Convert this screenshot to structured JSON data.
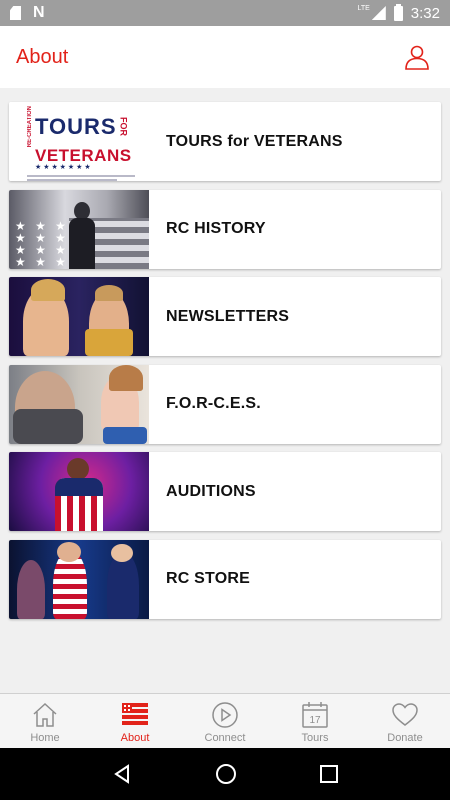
{
  "status_bar": {
    "network": "LTE",
    "time": "3:32",
    "icons": [
      "sd-card-icon",
      "n-notification-icon",
      "signal-icon",
      "battery-charging-icon"
    ]
  },
  "app_bar": {
    "title": "About",
    "profile_icon": "user-profile-icon",
    "accent_color": "#e2231a"
  },
  "items": [
    {
      "id": "tours",
      "label": "TOURS for VETERANS",
      "thumb": "tours-for-veterans-logo"
    },
    {
      "id": "history",
      "label": "RC HISTORY",
      "thumb": "speaker-with-flag-photo"
    },
    {
      "id": "newsletters",
      "label": "NEWSLETTERS",
      "thumb": "singers-duet-photo"
    },
    {
      "id": "forces",
      "label": "F.O.R-C.E.S.",
      "thumb": "veteran-and-performer-photo"
    },
    {
      "id": "auditions",
      "label": "AUDITIONS",
      "thumb": "performer-on-stage-photo"
    },
    {
      "id": "store",
      "label": "RC STORE",
      "thumb": "group-performance-photo"
    }
  ],
  "tours_logo": {
    "recreation": "RE-CREATION",
    "tours": "TOURS",
    "for": "FOR",
    "veterans": "VETERANS",
    "stars": "★ ★ ★ ★ ★ ★ ★"
  },
  "bottom_nav": [
    {
      "label": "Home",
      "icon": "home-icon",
      "active": false
    },
    {
      "label": "About",
      "icon": "flag-list-icon",
      "active": true
    },
    {
      "label": "Connect",
      "icon": "play-circle-icon",
      "active": false
    },
    {
      "label": "Tours",
      "icon": "calendar-icon",
      "active": false,
      "calendar_day": "17"
    },
    {
      "label": "Donate",
      "icon": "heart-icon",
      "active": false
    }
  ],
  "colors": {
    "accent": "#e2231a",
    "inactive_nav": "#8e8e8e",
    "status_bar": "#9e9e9e",
    "background": "#f0f0f0"
  }
}
